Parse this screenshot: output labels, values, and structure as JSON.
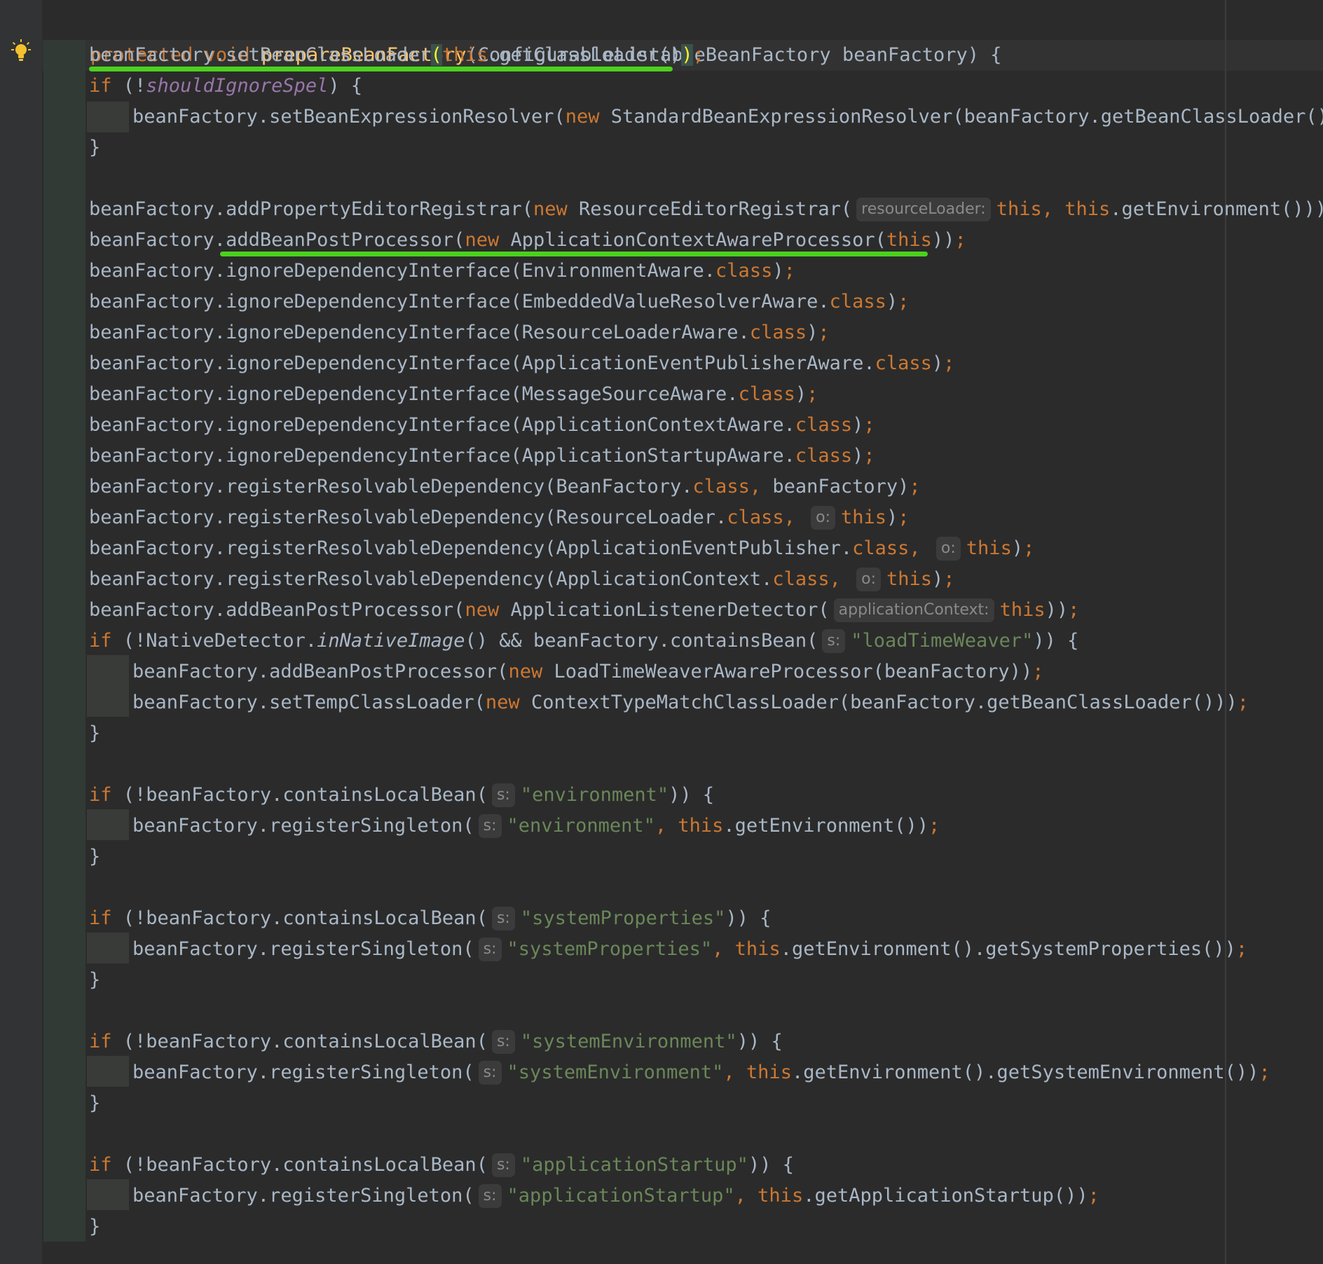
{
  "signature": {
    "kw1": "protected",
    "kw2": "void",
    "name": "prepareBeanFactory",
    "params": "(ConfigurableListableBeanFactory beanFactory) {"
  },
  "l1": {
    "a": "beanFactory.setBeanClassLoader",
    "b": "(",
    "c": "this",
    "d": ".getClassLoader()",
    "e": ")",
    "f": ";"
  },
  "l2": {
    "a": "if",
    "b": " (!",
    "c": "shouldIgnoreSpel",
    "d": ") {"
  },
  "l3": {
    "a": "beanFactory.setBeanExpressionResolver(",
    "b": "new",
    "c": " StandardBeanExpressionResolver(beanFactory.getBeanClassLoader()))",
    "d": ";"
  },
  "l4": {
    "a": "}"
  },
  "l5": {
    "a": "beanFactory.addPropertyEditorRegistrar(",
    "b": "new",
    "c": " ResourceEditorRegistrar(",
    "hint": "resourceLoader:",
    "d": "this",
    "e": ", ",
    "f": "this",
    "g": ".getEnvironment()))",
    "h": ";"
  },
  "l6": {
    "a": "beanFactory.addBeanPostProcessor(",
    "b": "new",
    "c": " ApplicationContextAwareProcessor(",
    "d": "this",
    "e": "))",
    "f": ";"
  },
  "l7": {
    "a": "beanFactory.ignoreDependencyInterface(EnvironmentAware.",
    "b": "class",
    "c": ")",
    "d": ";"
  },
  "l8": {
    "a": "beanFactory.ignoreDependencyInterface(EmbeddedValueResolverAware.",
    "b": "class",
    "c": ")",
    "d": ";"
  },
  "l9": {
    "a": "beanFactory.ignoreDependencyInterface(ResourceLoaderAware.",
    "b": "class",
    "c": ")",
    "d": ";"
  },
  "l10": {
    "a": "beanFactory.ignoreDependencyInterface(ApplicationEventPublisherAware.",
    "b": "class",
    "c": ")",
    "d": ";"
  },
  "l11": {
    "a": "beanFactory.ignoreDependencyInterface(MessageSourceAware.",
    "b": "class",
    "c": ")",
    "d": ";"
  },
  "l12": {
    "a": "beanFactory.ignoreDependencyInterface(ApplicationContextAware.",
    "b": "class",
    "c": ")",
    "d": ";"
  },
  "l13": {
    "a": "beanFactory.ignoreDependencyInterface(ApplicationStartupAware.",
    "b": "class",
    "c": ")",
    "d": ";"
  },
  "l14": {
    "a": "beanFactory.registerResolvableDependency(BeanFactory.",
    "b": "class",
    "c": ", ",
    "d": "beanFactory)",
    "e": ";"
  },
  "l15": {
    "a": "beanFactory.registerResolvableDependency(ResourceLoader.",
    "b": "class",
    "c": ", ",
    "hint": "o:",
    "d": "this",
    "e": ")",
    "f": ";"
  },
  "l16": {
    "a": "beanFactory.registerResolvableDependency(ApplicationEventPublisher.",
    "b": "class",
    "c": ", ",
    "hint": "o:",
    "d": "this",
    "e": ")",
    "f": ";"
  },
  "l17": {
    "a": "beanFactory.registerResolvableDependency(ApplicationContext.",
    "b": "class",
    "c": ", ",
    "hint": "o:",
    "d": "this",
    "e": ")",
    "f": ";"
  },
  "l18": {
    "a": "beanFactory.addBeanPostProcessor(",
    "b": "new",
    "c": " ApplicationListenerDetector(",
    "hint": "applicationContext:",
    "d": "this",
    "e": "))",
    "f": ";"
  },
  "l19": {
    "a": "if",
    "b": " (!NativeDetector.",
    "c": "inNativeImage",
    "d": "() && beanFactory.containsBean(",
    "hint": "s:",
    "e": "\"loadTimeWeaver\"",
    "f": ")) {"
  },
  "l20": {
    "a": "beanFactory.addBeanPostProcessor(",
    "b": "new",
    "c": " LoadTimeWeaverAwareProcessor(beanFactory))",
    "d": ";"
  },
  "l21": {
    "a": "beanFactory.setTempClassLoader(",
    "b": "new",
    "c": " ContextTypeMatchClassLoader(beanFactory.getBeanClassLoader()))",
    "d": ";"
  },
  "l22": {
    "a": "}"
  },
  "l23": {
    "a": "if",
    "b": " (!beanFactory.containsLocalBean(",
    "hint": "s:",
    "c": "\"environment\"",
    "d": ")) {"
  },
  "l24": {
    "a": "beanFactory.registerSingleton(",
    "hint": "s:",
    "b": "\"environment\"",
    "c": ", ",
    "d": "this",
    "e": ".getEnvironment())",
    "f": ";"
  },
  "l25": {
    "a": "}"
  },
  "l26": {
    "a": "if",
    "b": " (!beanFactory.containsLocalBean(",
    "hint": "s:",
    "c": "\"systemProperties\"",
    "d": ")) {"
  },
  "l27": {
    "a": "beanFactory.registerSingleton(",
    "hint": "s:",
    "b": "\"systemProperties\"",
    "c": ", ",
    "d": "this",
    "e": ".getEnvironment().getSystemProperties())",
    "f": ";"
  },
  "l28": {
    "a": "}"
  },
  "l29": {
    "a": "if",
    "b": " (!beanFactory.containsLocalBean(",
    "hint": "s:",
    "c": "\"systemEnvironment\"",
    "d": ")) {"
  },
  "l30": {
    "a": "beanFactory.registerSingleton(",
    "hint": "s:",
    "b": "\"systemEnvironment\"",
    "c": ", ",
    "d": "this",
    "e": ".getEnvironment().getSystemEnvironment())",
    "f": ";"
  },
  "l31": {
    "a": "}"
  },
  "l32": {
    "a": "if",
    "b": " (!beanFactory.containsLocalBean(",
    "hint": "s:",
    "c": "\"applicationStartup\"",
    "d": ")) {"
  },
  "l33": {
    "a": "beanFactory.registerSingleton(",
    "hint": "s:",
    "b": "\"applicationStartup\"",
    "c": ", ",
    "d": "this",
    "e": ".getApplicationStartup())",
    "f": ";"
  },
  "l34": {
    "a": "}"
  },
  "colors": {
    "background": "#2b2b2b",
    "keyword": "#cc7832",
    "method_decl": "#ffc66d",
    "string": "#6a8759",
    "field": "#9876aa",
    "text": "#a9b7c6",
    "annotation_underline": "#4cd11e"
  },
  "icons": {
    "gutter_action": "lightbulb-icon"
  }
}
